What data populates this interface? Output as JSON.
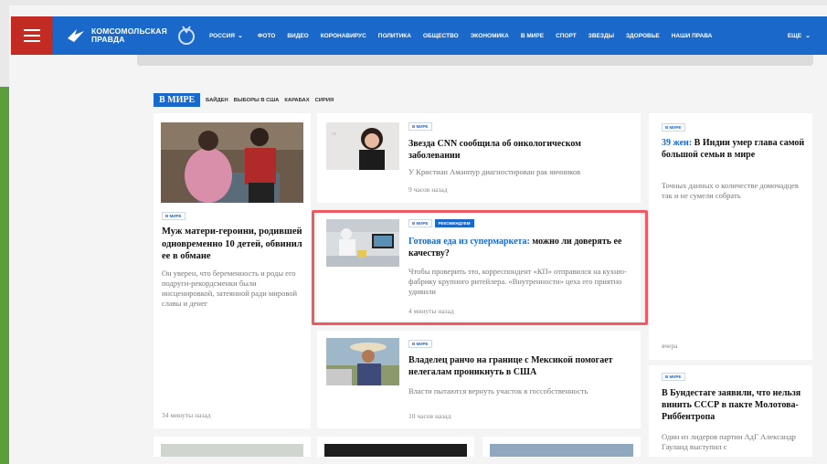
{
  "header": {
    "logo_line1": "Комсомольская",
    "logo_line2": "Правда",
    "region": "Россия",
    "nav": [
      "Фото",
      "Видео",
      "Коронавирус",
      "Политика",
      "Общество",
      "Экономика",
      "В мире",
      "Спорт",
      "Звезды",
      "Здоровье",
      "Наши права"
    ],
    "more": "Еще"
  },
  "section": {
    "title": "В МИРЕ",
    "tags": [
      "Байден",
      "Выборы в США",
      "Карабах",
      "Сирия"
    ]
  },
  "left_card": {
    "label": "В мире",
    "headline": "Муж матери-героини, родившей одновременно 10 детей, обвинил ее в обмане",
    "summary": "Он уверен, что беременность и роды его подруги-рекордсменки были инсценировкой, затеянной ради мировой славы и денег",
    "time": "34 минуты назад"
  },
  "mid_cards": [
    {
      "label": "В мире",
      "headline": "Звезда CNN сообщила об онкологическом заболевании",
      "summary": "У Кристиан Аманпур диагностирован рак яичников",
      "time": "9 часов назад"
    },
    {
      "label": "В мире",
      "badge": "Рекомендуем",
      "headline_accent": "Готовая еда из супермаркета:",
      "headline_rest": " можно ли доверять ее качеству?",
      "summary": "Чтобы проверить это, корреспондент «КП» отправился на кухню-фабрику крупного ритейлера. «Внутренности» цеха его приятно удивили",
      "time": "4 минуты назад"
    },
    {
      "label": "В мире",
      "headline": "Владелец ранчо на границе с Мексикой помогает нелегалам проникнуть в США",
      "summary": "Власти пытаются вернуть участок в госсобственность",
      "time": "10 часов назад"
    }
  ],
  "right_cards": [
    {
      "label": "В мире",
      "headline_accent": "39 жен:",
      "headline_rest": " В Индии умер глава самой большой семьи в мире",
      "summary": "Точных данных о количестве домочадцев так и не сумели собрать",
      "time": "вчера"
    },
    {
      "label": "В мире",
      "headline": "В Бундестаге заявили, что нельзя винить СССР в пакте Молотова-Риббентропа",
      "summary": "Один из лидеров партии АдГ Александр Гауланд выступил с"
    }
  ],
  "colors": {
    "brand_blue": "#1a68c9",
    "menu_red": "#c22b22",
    "highlight": "#ef5a62"
  }
}
